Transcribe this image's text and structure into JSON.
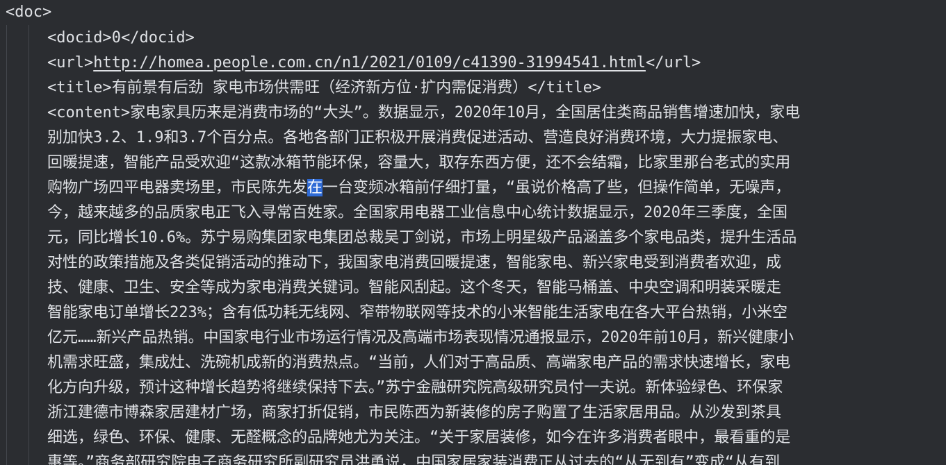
{
  "doc_open": "<doc>",
  "docid_line": "<docid>0</docid>",
  "url": {
    "open": "<url>",
    "href": "http://homea.people.com.cn/n1/2021/0109/c41390-31994541.html",
    "close": "</url>"
  },
  "title_line": "<title>有前景有后劲 家电市场供需旺（经济新方位·扩内需促消费）</title>",
  "content_lines": [
    "<content>家电家具历来是消费市场的“大头”。数据显示，2020年10月，全国居住类商品销售增速加快，家电",
    "别加快3.2、1.9和3.7个百分点。各地各部门正积极开展消费促进活动、营造良好消费环境，大力提振家电、",
    "回暖提速，智能产品受欢迎“这款冰箱节能环保，容量大，取存东西方便，还不会结霜，比家里那台老式的实用",
    "购物广场四平电器卖场里，市民陈先发",
    "今，越来越多的品质家电正飞入寻常百姓家。全国家用电器工业信息中心统计数据显示，2020年三季度，全国",
    "元，同比增长10.6%。苏宁易购集团家电集团总裁吴丁剑说，市场上明星级产品涵盖多个家电品类，提升生活品",
    "对性的政策措施及各类促销活动的推动下，我国家电消费回暖提速，智能家电、新兴家电受到消费者欢迎，成",
    "技、健康、卫生、安全等成为家电消费关键词。智能风刮起。这个冬天，智能马桶盖、中央空调和明装采暖走",
    "智能家电订单增长223%；含有低功耗无线网、窄带物联网等技术的小米智能生活家电在各大平台热销，小米空",
    "亿元……新兴产品热销。中国家电行业市场运行情况及高端市场表现情况通报显示，2020年前10月，新兴健康小",
    "机需求旺盛，集成灶、洗碗机成新的消费热点。“当前，人们对于高品质、高端家电产品的需求快速增长，家电",
    "化方向升级，预计这种增长趋势将继续保持下去。”苏宁金融研究院高级研究员付一夫说。新体验绿色、环保家",
    "浙江建德市博森家居建材广场，商家打折促销，市民陈西为新装修的房子购置了生活家居用品。从沙发到茶具",
    "细选，绿色、环保、健康、无醛概念的品牌她尤为关注。“关于家居装修，如今在许多消费者眼中，最看重的是",
    "惠等。”商务部研究院电子商务研究所副研究员洪勇说，中国家居家装消费正从过去的“从无到有”变成“从有到"
  ],
  "selected_char": "在",
  "line4_rest": "一台变频冰箱前仔细打量，“虽说价格高了些，但操作简单，无噪声，"
}
